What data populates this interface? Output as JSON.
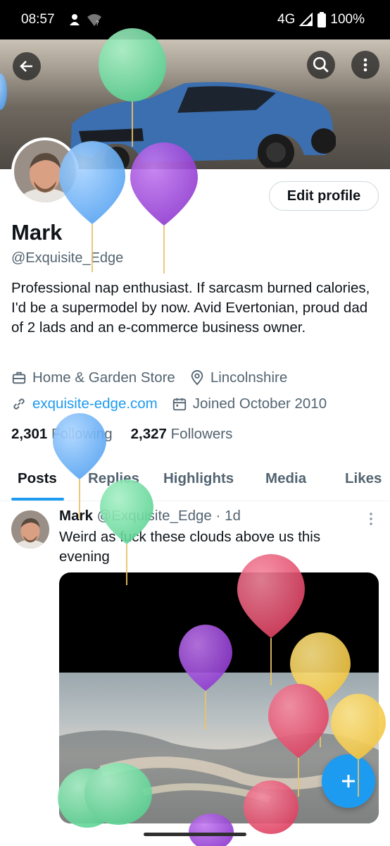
{
  "status_bar": {
    "time": "08:57",
    "network": "4G",
    "battery": "100%"
  },
  "header": {
    "back_icon": "arrow-left-icon",
    "search_icon": "search-icon",
    "more_icon": "more-vertical-icon"
  },
  "profile": {
    "edit_label": "Edit profile",
    "name": "Mark",
    "handle": "@Exquisite_Edge",
    "bio": "Professional nap enthusiast. If sarcasm burned calories, I'd be a supermodel by now. Avid Evertonian, proud dad of 2 lads and an e-commerce business owner.",
    "category": "Home & Garden Store",
    "location": "Lincolnshire",
    "website": "exquisite-edge.com",
    "joined": "Joined October 2010",
    "following_count": "2,301",
    "following_label": "Following",
    "followers_count": "2,327",
    "followers_label": "Followers"
  },
  "tabs": [
    "Posts",
    "Replies",
    "Highlights",
    "Media",
    "Likes"
  ],
  "post": {
    "author": "Mark",
    "handle": "@Exquisite_Edge",
    "time": "· 1d",
    "text": "Weird as fuck these clouds above us this evening"
  },
  "colors": {
    "accent": "#1d9bf0",
    "text": "#0f1419",
    "secondary": "#536471"
  }
}
